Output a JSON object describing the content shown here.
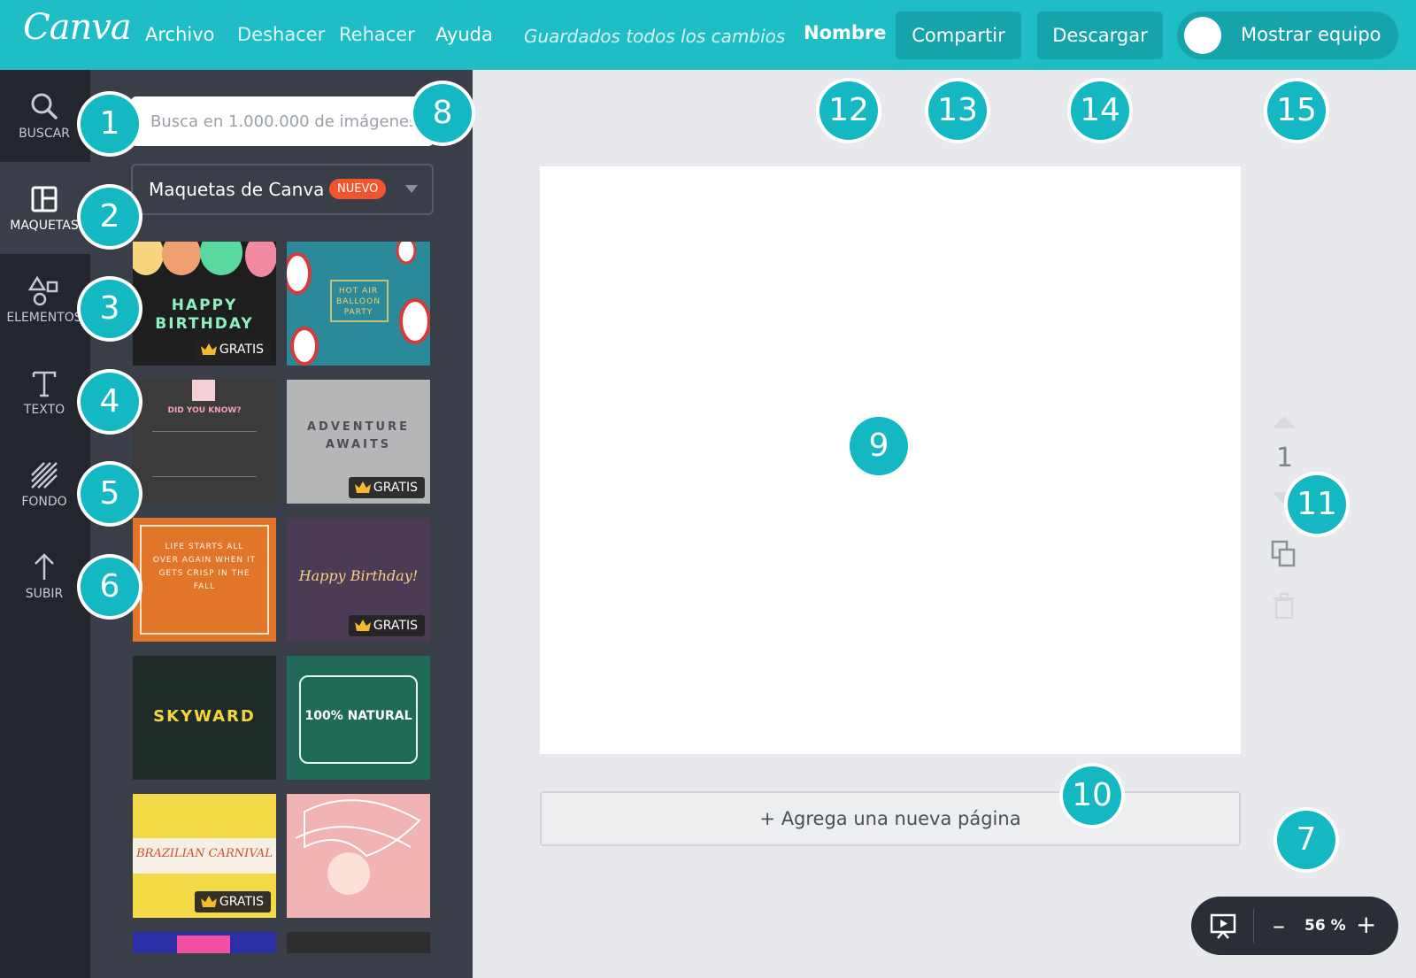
{
  "topbar": {
    "logo": "Canva",
    "menu": [
      "Archivo",
      "Deshacer",
      "Rehacer",
      "Ayuda"
    ],
    "saved_status": "Guardados todos los cambios",
    "name_label": "Nombre",
    "share_label": "Compartir",
    "download_label": "Descargar",
    "team_toggle_label": "Mostrar equipo",
    "colors": {
      "bar": "#1fbdc6",
      "button": "#17a3ab"
    }
  },
  "sidebar": {
    "items": [
      {
        "label": "BUSCAR",
        "icon": "search-icon"
      },
      {
        "label": "MAQUETAS",
        "icon": "layouts-icon"
      },
      {
        "label": "ELEMENTOS",
        "icon": "shapes-icon"
      },
      {
        "label": "TEXTO",
        "icon": "text-icon"
      },
      {
        "label": "FONDO",
        "icon": "background-icon"
      },
      {
        "label": "SUBIR",
        "icon": "upload-icon"
      }
    ],
    "active_index": 1
  },
  "panel": {
    "search_placeholder": "Busca en 1.000.000 de imágenes...",
    "dropdown_label": "Maquetas de Canva",
    "new_badge": "NUEVO",
    "free_badge": "GRATIS",
    "templates": [
      {
        "text": "HAPPY BIRTHDAY",
        "free": true
      },
      {
        "text": "HOT AIR BALLOON PARTY",
        "free": false
      },
      {
        "text": "DID YOU KNOW?",
        "free": false
      },
      {
        "text": "ADVENTURE AWAITS",
        "free": true
      },
      {
        "text": "LIFE STARTS ALL OVER AGAIN WHEN IT GETS CRISP IN THE FALL",
        "free": false
      },
      {
        "text": "Happy Birthday!",
        "free": true
      },
      {
        "text": "SKYWARD",
        "free": false
      },
      {
        "text": "100% NATURAL",
        "free": false
      },
      {
        "text": "BRAZILIAN CARNIVAL",
        "free": true
      },
      {
        "text": "",
        "free": false
      }
    ]
  },
  "canvas": {
    "add_page_label": "+ Agrega una nueva página",
    "page_number": "1",
    "zoom_level": "56 %"
  },
  "callouts": [
    "1",
    "2",
    "3",
    "4",
    "5",
    "6",
    "7",
    "8",
    "9",
    "10",
    "11",
    "12",
    "13",
    "14",
    "15"
  ]
}
